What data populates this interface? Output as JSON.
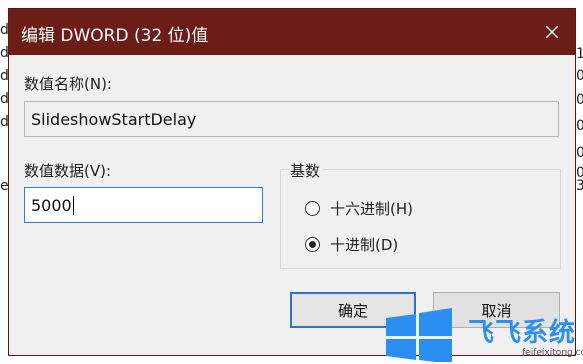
{
  "background": {
    "left_fragments": [
      "d",
      "d",
      "d",
      "d",
      "d",
      "e"
    ],
    "right_fragments": [
      "1",
      "0",
      "0",
      "0",
      "0",
      "0",
      "3"
    ]
  },
  "dialog": {
    "title": "编辑 DWORD (32 位)值",
    "close_icon": "close-icon",
    "value_name_label": "数值名称(N):",
    "value_name": "SlideshowStartDelay",
    "value_data_label": "数值数据(V):",
    "value_data": "5000",
    "base_group_label": "基数",
    "radio_hex": "十六进制(H)",
    "radio_dec": "十进制(D)",
    "selected_base": "decimal",
    "ok_label": "确定",
    "cancel_label": "取消"
  },
  "watermark": {
    "text": "飞飞系统",
    "url": "feifeixitong.com"
  },
  "colors": {
    "titlebar": "#6b1d16",
    "accent": "#2b73c7",
    "dialog_bg": "#f0f0f0",
    "watermark": "#2a8ff0"
  }
}
